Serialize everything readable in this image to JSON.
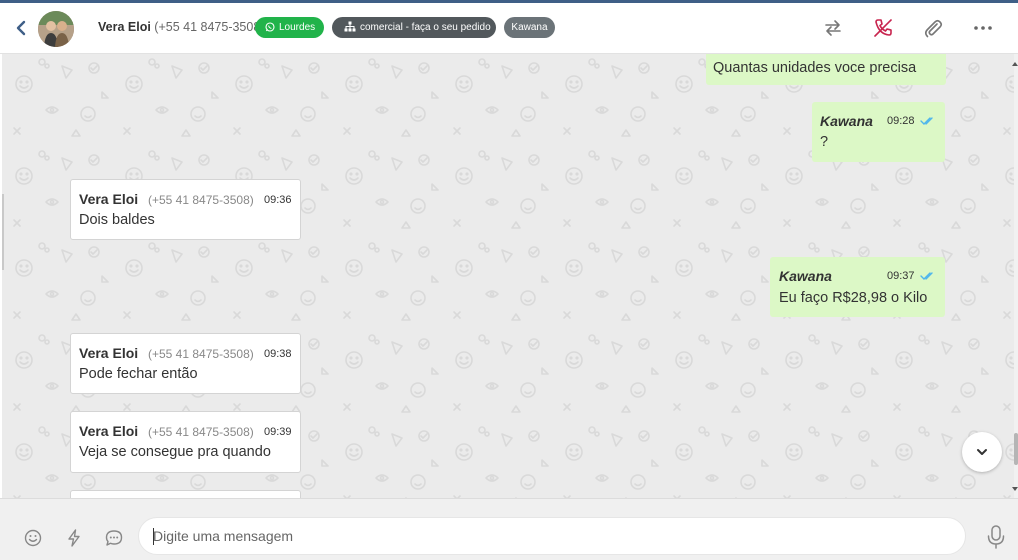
{
  "header": {
    "contact_name": "Vera Eloi",
    "contact_phone": "(+55 41 8475-3508)",
    "tags": {
      "channel": "Lourdes",
      "department": "comercial - faça o seu pedido",
      "agent": "Kawana"
    }
  },
  "messages": [
    {
      "direction": "out",
      "sender": "",
      "time": "",
      "text": "Quantas unidades voce precisa"
    },
    {
      "direction": "out",
      "sender": "Kawana",
      "time": "09:28",
      "text": "?"
    },
    {
      "direction": "in",
      "sender": "Vera Eloi",
      "phone": "(+55 41 8475-3508)",
      "time": "09:36",
      "text": "Dois baldes"
    },
    {
      "direction": "out",
      "sender": "Kawana",
      "time": "09:37",
      "text": "Eu faço R$28,98 o Kilo"
    },
    {
      "direction": "in",
      "sender": "Vera Eloi",
      "phone": "(+55 41 8475-3508)",
      "time": "09:38",
      "text": "Pode fechar então"
    },
    {
      "direction": "in",
      "sender": "Vera Eloi",
      "phone": "(+55 41 8475-3508)",
      "time": "09:39",
      "text": "Veja se consegue pra quando"
    }
  ],
  "composer": {
    "placeholder": "Digite uma mensagem"
  },
  "icons": {
    "back": "chevron-left-icon",
    "channel": "whatsapp-icon",
    "department": "sitemap-icon",
    "transfer": "transfer-arrows-icon",
    "end_call": "phone-off-icon",
    "attach": "paperclip-icon",
    "more": "more-horizontal-icon",
    "scroll_down": "chevron-down-icon",
    "emoji": "emoji-icon",
    "quick_reply": "lightning-icon",
    "chat_templates": "chat-bubble-icon",
    "mic": "microphone-icon"
  },
  "colors": {
    "accent_top": "#3f5f87",
    "tag_channel": "#21b34a",
    "tag_department": "#52585c",
    "tag_agent": "#6b7378",
    "bubble_out": "#dcf8c6",
    "bubble_in": "#ffffff",
    "chat_background": "#ebebeb",
    "read_ticks": "#4fb6ec",
    "end_call": "#c8254f"
  }
}
